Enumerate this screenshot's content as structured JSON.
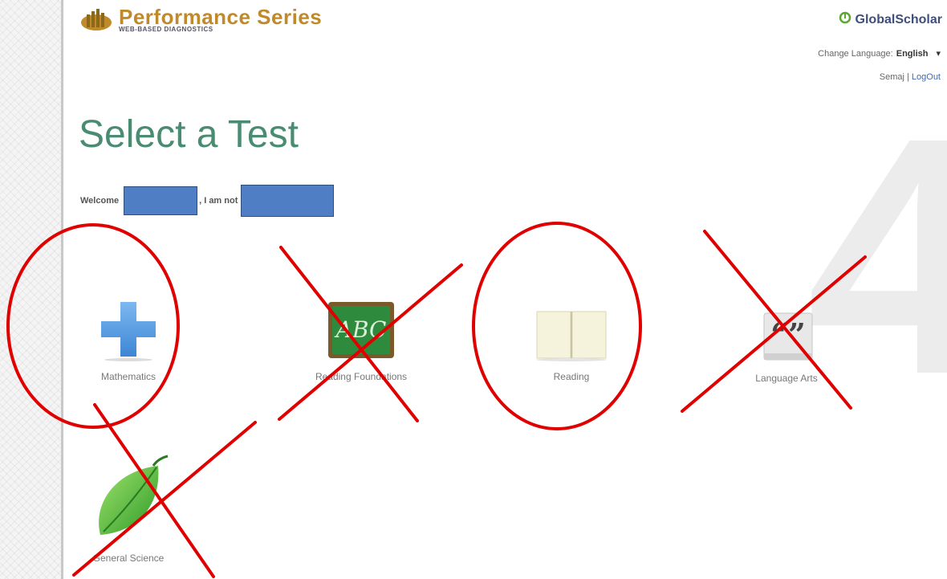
{
  "header": {
    "logo_title": "Performance Series",
    "logo_subtitle": "WEB-BASED DIAGNOSTICS",
    "brand": "GlobalScholar",
    "change_language_label": "Change Language:",
    "language_value": "English",
    "user_name": "Semaj",
    "separator": "|",
    "logout_label": "LogOut"
  },
  "main": {
    "title": "Select a Test",
    "welcome_label": "Welcome",
    "not_label": ", I am not",
    "grade": "4"
  },
  "tests": [
    {
      "label": "Mathematics",
      "icon": "plus-icon",
      "annotation": "circled"
    },
    {
      "label": "Reading Foundations",
      "icon": "chalkboard-abc-icon",
      "annotation": "crossed-out"
    },
    {
      "label": "Reading",
      "icon": "open-book-icon",
      "annotation": "circled"
    },
    {
      "label": "Language Arts",
      "icon": "quote-marks-icon",
      "annotation": "crossed-out"
    },
    {
      "label": "General Science",
      "icon": "leaf-icon",
      "annotation": "crossed-out"
    }
  ],
  "colors": {
    "title": "#4a8c72",
    "logo": "#c08a2a",
    "annotation": "#e00000",
    "redaction": "#4f7ec4",
    "link": "#3b6bb5"
  }
}
